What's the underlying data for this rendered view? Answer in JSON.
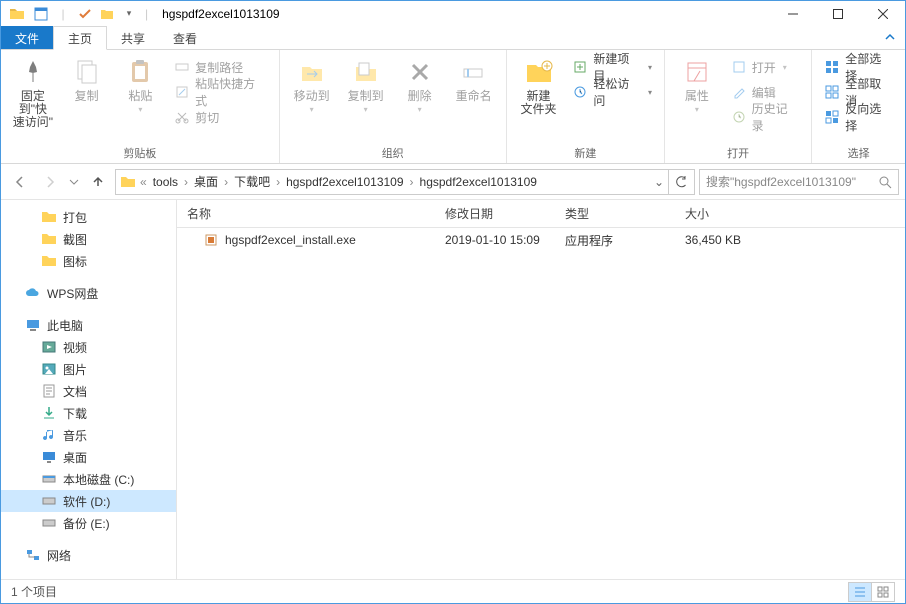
{
  "titlebar": {
    "title": "hgspdf2excel1013109"
  },
  "tabs": {
    "file": "文件",
    "home": "主页",
    "share": "共享",
    "view": "查看"
  },
  "ribbon": {
    "pin": "固定到\"快\n速访问\"",
    "copy": "复制",
    "paste": "粘贴",
    "copy_path": "复制路径",
    "paste_shortcut": "粘贴快捷方式",
    "cut": "剪切",
    "clipboard_group": "剪贴板",
    "move_to": "移动到",
    "copy_to": "复制到",
    "delete": "删除",
    "rename": "重命名",
    "organize_group": "组织",
    "new_folder": "新建\n文件夹",
    "new_item": "新建项目",
    "easy_access": "轻松访问",
    "new_group": "新建",
    "properties": "属性",
    "open": "打开",
    "edit": "编辑",
    "history": "历史记录",
    "open_group": "打开",
    "select_all": "全部选择",
    "select_none": "全部取消",
    "invert_sel": "反向选择",
    "select_group": "选择"
  },
  "breadcrumb": {
    "segs": [
      "tools",
      "桌面",
      "下载吧",
      "hgspdf2excel1013109",
      "hgspdf2excel1013109"
    ]
  },
  "search": {
    "placeholder": "搜索\"hgspdf2excel1013109\""
  },
  "sidebar": {
    "dabao": "打包",
    "jietu": "截图",
    "tubiao": "图标",
    "wps": "WPS网盘",
    "thispc": "此电脑",
    "video": "视频",
    "pictures": "图片",
    "docs": "文档",
    "downloads": "下载",
    "music": "音乐",
    "desktop": "桌面",
    "diskc": "本地磁盘 (C:)",
    "diskd": "软件 (D:)",
    "diske": "备份 (E:)",
    "network": "网络"
  },
  "columns": {
    "name": "名称",
    "date": "修改日期",
    "type": "类型",
    "size": "大小"
  },
  "rows": [
    {
      "name": "hgspdf2excel_install.exe",
      "date": "2019-01-10 15:09",
      "type": "应用程序",
      "size": "36,450 KB"
    }
  ],
  "statusbar": {
    "count": "1 个项目"
  }
}
